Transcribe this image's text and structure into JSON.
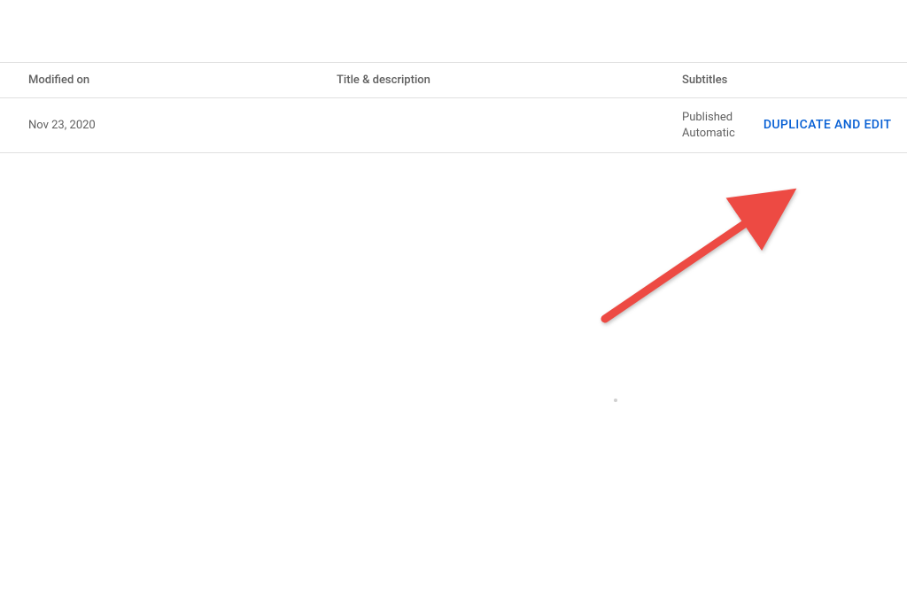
{
  "table": {
    "headers": {
      "modified": "Modified on",
      "title": "Title & description",
      "subtitles": "Subtitles"
    },
    "rows": [
      {
        "modified": "Nov 23, 2020",
        "title": "",
        "subtitles_status": "Published",
        "subtitles_type": "Automatic",
        "action_label": "DUPLICATE AND EDIT"
      }
    ]
  },
  "colors": {
    "link": "#065fd4",
    "arrow": "#ed4a43",
    "text_muted": "#606060",
    "border": "#e0e0e0"
  }
}
